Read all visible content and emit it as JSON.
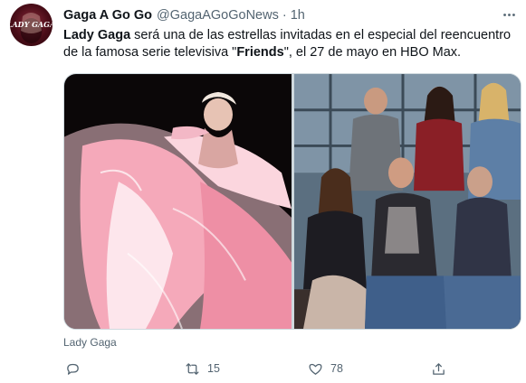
{
  "tweet": {
    "author_name": "Gaga A Go Go",
    "author_handle": "@GagaAGoGoNews",
    "separator": "·",
    "timestamp": "1h",
    "avatar_text": "LADY GAGA",
    "text_parts": [
      {
        "text": "Lady Gaga",
        "bold": true
      },
      {
        "text": " será una de las estrellas invitadas en el especial del reencuentro de la famosa serie televisiva \"",
        "bold": false
      },
      {
        "text": "Friends",
        "bold": true
      },
      {
        "text": "\", el 27 de mayo en HBO Max.",
        "bold": false
      }
    ],
    "media_caption": "Lady Gaga",
    "counts": {
      "replies": "",
      "retweets": "15",
      "likes": "78"
    }
  },
  "icons": {
    "more": "more-horizontal-icon",
    "reply": "reply-icon",
    "retweet": "retweet-icon",
    "like": "heart-icon",
    "share": "share-icon"
  },
  "colors": {
    "text_primary": "#0f1419",
    "text_secondary": "#536471",
    "border": "#cfd9de",
    "avatar_bg": "#5a0f1d"
  }
}
